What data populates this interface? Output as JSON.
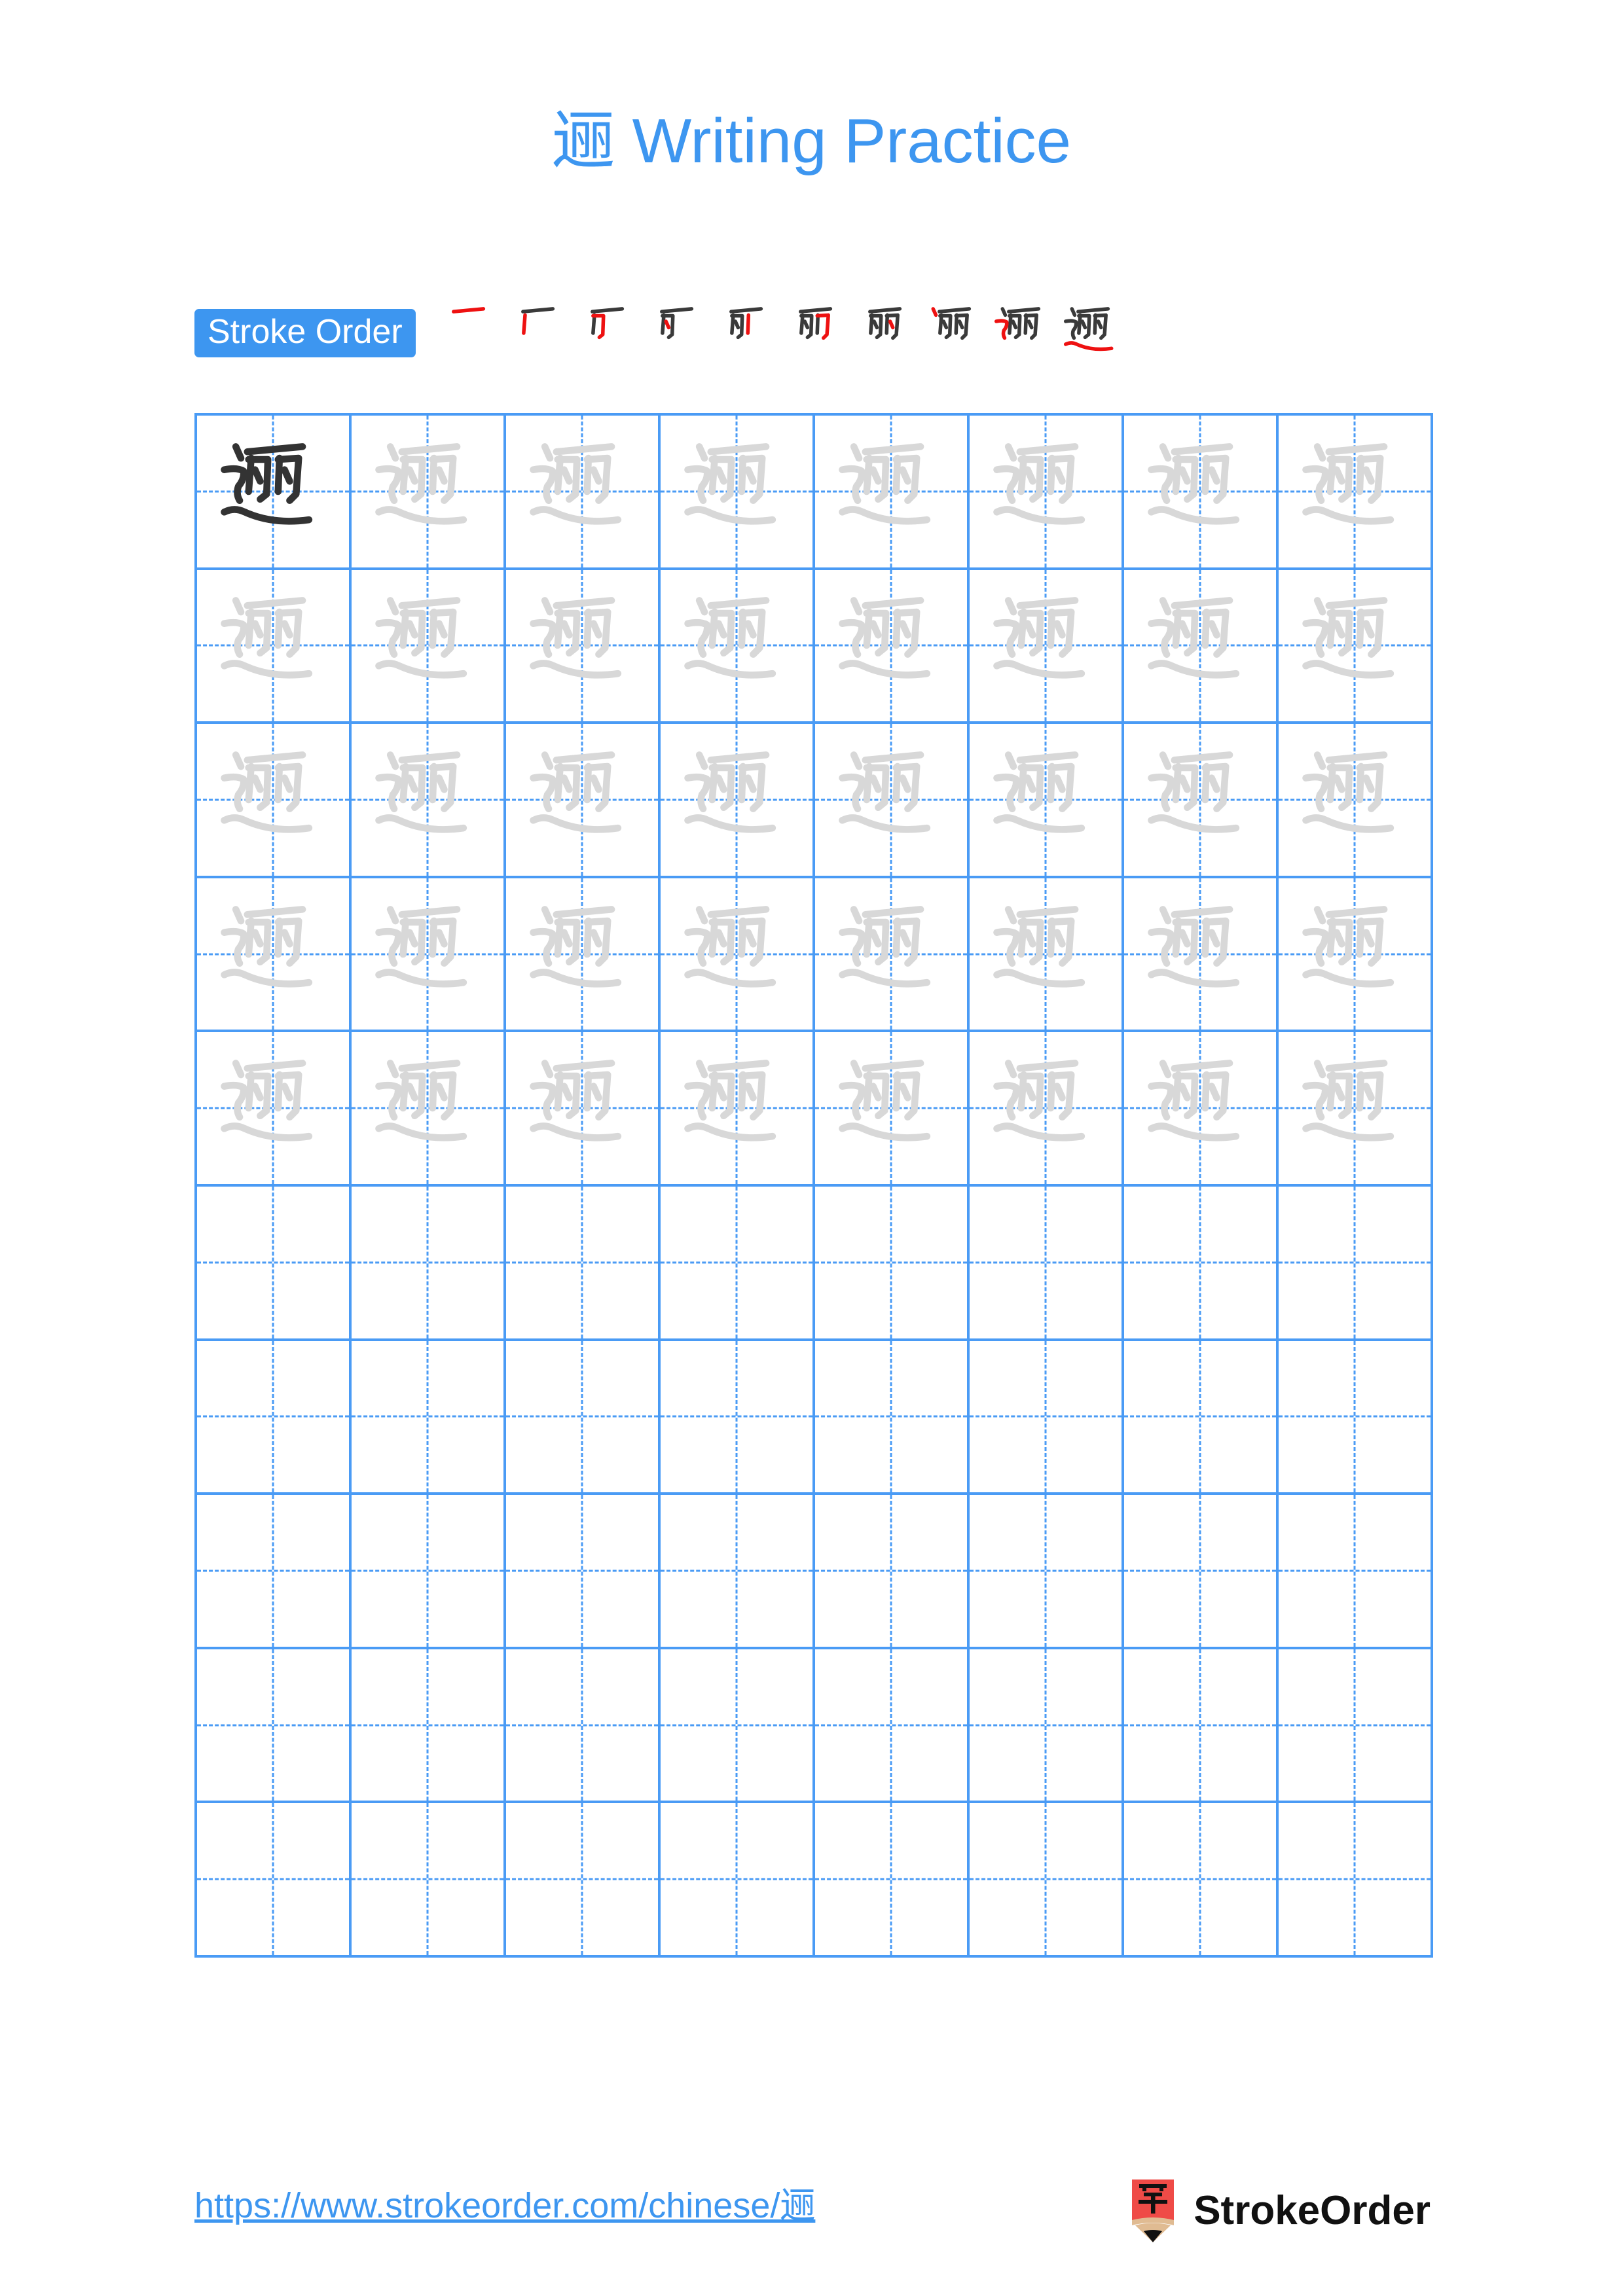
{
  "document": {
    "type": "chinese-character-writing-practice-worksheet",
    "character": "逦",
    "title_suffix": "Writing Practice",
    "title_full": "逦 Writing Practice",
    "accent_color": "#3d96f0",
    "grid_line_color": "#4a9bf5",
    "traced_char_color": "#d8d8d8",
    "model_char_color": "#333333",
    "new_stroke_color": "#ee1111",
    "drawn_stroke_color": "#3a3a3a"
  },
  "stroke_order": {
    "badge_label": "Stroke Order",
    "total_strokes": 10,
    "steps": [
      {
        "index": 1,
        "strokes_shown": 1,
        "new_stroke": "héng (horizontal)"
      },
      {
        "index": 2,
        "strokes_shown": 2,
        "new_stroke": "shù (vertical)"
      },
      {
        "index": 3,
        "strokes_shown": 3,
        "new_stroke": "héng-zhé-gōu"
      },
      {
        "index": 4,
        "strokes_shown": 4,
        "new_stroke": "diǎn (dot)"
      },
      {
        "index": 5,
        "strokes_shown": 5,
        "new_stroke": "shù (vertical)"
      },
      {
        "index": 6,
        "strokes_shown": 6,
        "new_stroke": "héng-zhé-gōu"
      },
      {
        "index": 7,
        "strokes_shown": 7,
        "new_stroke": "diǎn (dot)"
      },
      {
        "index": 8,
        "strokes_shown": 8,
        "new_stroke": "diǎn (dot)"
      },
      {
        "index": 9,
        "strokes_shown": 9,
        "new_stroke": "héng-zhé-zhé-piě"
      },
      {
        "index": 10,
        "strokes_shown": 10,
        "new_stroke": "píng-nà (flat press)"
      }
    ]
  },
  "practice_grid": {
    "columns": 8,
    "rows": 10,
    "rows_with_characters": 5,
    "empty_rows": 5,
    "model_cell": {
      "row": 1,
      "column": 1
    },
    "cells": [
      [
        "model",
        "trace",
        "trace",
        "trace",
        "trace",
        "trace",
        "trace",
        "trace"
      ],
      [
        "trace",
        "trace",
        "trace",
        "trace",
        "trace",
        "trace",
        "trace",
        "trace"
      ],
      [
        "trace",
        "trace",
        "trace",
        "trace",
        "trace",
        "trace",
        "trace",
        "trace"
      ],
      [
        "trace",
        "trace",
        "trace",
        "trace",
        "trace",
        "trace",
        "trace",
        "trace"
      ],
      [
        "trace",
        "trace",
        "trace",
        "trace",
        "trace",
        "trace",
        "trace",
        "trace"
      ],
      [
        "empty",
        "empty",
        "empty",
        "empty",
        "empty",
        "empty",
        "empty",
        "empty"
      ],
      [
        "empty",
        "empty",
        "empty",
        "empty",
        "empty",
        "empty",
        "empty",
        "empty"
      ],
      [
        "empty",
        "empty",
        "empty",
        "empty",
        "empty",
        "empty",
        "empty",
        "empty"
      ],
      [
        "empty",
        "empty",
        "empty",
        "empty",
        "empty",
        "empty",
        "empty",
        "empty"
      ],
      [
        "empty",
        "empty",
        "empty",
        "empty",
        "empty",
        "empty",
        "empty",
        "empty"
      ]
    ]
  },
  "footer": {
    "url": "https://www.strokeorder.com/chinese/逦",
    "brand_name": "StrokeOrder",
    "logo_char": "字",
    "logo_body_color": "#ef4b47",
    "logo_wood_color": "#e0bb92",
    "logo_tip_color": "#111111"
  }
}
